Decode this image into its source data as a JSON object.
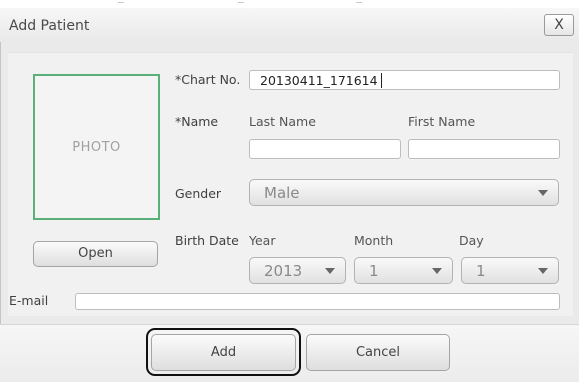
{
  "dialog": {
    "title": "Add Patient",
    "close_label": "X"
  },
  "photo": {
    "placeholder": "PHOTO",
    "open_label": "Open"
  },
  "form": {
    "chart_no": {
      "label": "*Chart No.",
      "value": "20130411_171614"
    },
    "name": {
      "label": "*Name",
      "last_label": "Last Name",
      "first_label": "First Name",
      "last_value": "",
      "first_value": ""
    },
    "gender": {
      "label": "Gender",
      "value": "Male"
    },
    "birth_date": {
      "label": "Birth Date",
      "year_label": "Year",
      "month_label": "Month",
      "day_label": "Day",
      "year_value": "2013",
      "month_value": "1",
      "day_value": "1"
    },
    "email": {
      "label": "E-mail",
      "value": ""
    }
  },
  "footer": {
    "add_label": "Add",
    "cancel_label": "Cancel"
  }
}
